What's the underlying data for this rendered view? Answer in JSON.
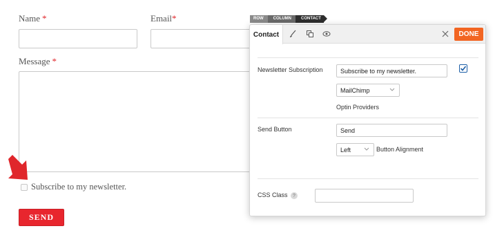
{
  "form": {
    "name_label": "Name",
    "email_label": "Email",
    "message_label": "Message",
    "required_mark": "*",
    "newsletter_label": "Subscribe to my newsletter.",
    "send_label": "SEND"
  },
  "breadcrumb": [
    "ROW",
    "COLUMN",
    "CONTACT"
  ],
  "panel": {
    "tab_label": "Contact",
    "tab_icons": [
      "brush-icon",
      "layers-icon",
      "eye-icon"
    ],
    "done_label": "DONE",
    "newsletter": {
      "label": "Newsletter Subscription",
      "value": "Subscribe to my newsletter.",
      "checked": true,
      "provider": "MailChimp",
      "provider_hint": "Optin Providers"
    },
    "send_button": {
      "label": "Send Button",
      "value": "Send",
      "alignment": "Left",
      "alignment_label": "Button Alignment"
    },
    "css_class": {
      "label": "CSS Class",
      "help": "?",
      "value": ""
    }
  },
  "colors": {
    "accent_red": "#e8262e",
    "done_orange": "#f26522",
    "arrow_red": "#e0262b",
    "checkbox_blue": "#1a5da6"
  }
}
